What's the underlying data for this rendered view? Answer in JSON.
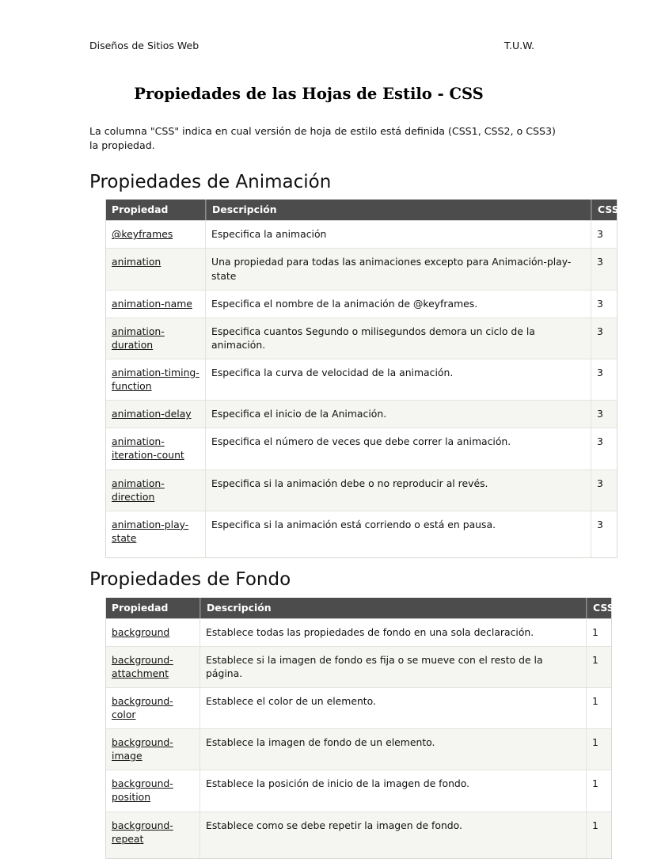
{
  "header": {
    "left": "Diseños de Sitios Web",
    "right": "T.U.W."
  },
  "title": "Propiedades de las Hojas de Estilo - CSS",
  "intro": "La columna \"CSS\" indica en cual versión de hoja de estilo está definida (CSS1, CSS2, o CSS3) la propiedad.",
  "columns": {
    "property": "Propiedad",
    "description": "Descripción",
    "css": "CSS"
  },
  "sections": [
    {
      "heading": "Propiedades de Animación",
      "rows": [
        {
          "property": "@keyframes",
          "description": "Especifica la animación",
          "css": "3"
        },
        {
          "property": "animation",
          "description": "Una propiedad para todas las animaciones excepto para Animación-play-state",
          "css": "3"
        },
        {
          "property": "animation-name",
          "description": "Especifica el nombre de la animación de @keyframes.",
          "css": "3"
        },
        {
          "property": "animation-duration",
          "description": "Especifica cuantos Segundo o milisegundos demora un ciclo de la animación.",
          "css": "3"
        },
        {
          "property": "animation-timing-function",
          "description": "Especifica la curva de velocidad de la animación.",
          "css": "3"
        },
        {
          "property": "animation-delay",
          "description": "Especifica el inicio de la Animación.",
          "css": "3"
        },
        {
          "property": "animation-iteration-count",
          "description": "Especifica el número de veces que debe correr la animación.",
          "css": "3"
        },
        {
          "property": "animation-direction",
          "description": "Especifica si la animación debe o no reproducir al revés.",
          "css": "3"
        },
        {
          "property": "animation-play-state",
          "description": "Especifica si la animación está corriendo o está en pausa.",
          "css": "3"
        }
      ]
    },
    {
      "heading": "Propiedades de Fondo",
      "rows": [
        {
          "property": "background",
          "description": "Establece todas las propiedades de fondo en una sola declaración.",
          "css": "1"
        },
        {
          "property": "background-attachment",
          "description": "Establece si la imagen de fondo es fija o se mueve con el resto de la página.",
          "css": "1"
        },
        {
          "property": "background-color",
          "description": "Establece el color de un elemento.",
          "css": "1"
        },
        {
          "property": "background-image",
          "description": "Establece la imagen de fondo de un elemento.",
          "css": "1"
        },
        {
          "property": "background-position",
          "description": "Establece la posición de inicio de la imagen de fondo.",
          "css": "1"
        },
        {
          "property": "background-repeat",
          "description": "Establece como se debe repetir la imagen de fondo.",
          "css": "1"
        }
      ]
    }
  ],
  "colors": {
    "table_header_bg": "#4c4c4c",
    "table_header_text": "#ffffff",
    "row_alt_bg": "#f5f5f1",
    "page_bg": "#ffffff",
    "text": "#111111"
  }
}
